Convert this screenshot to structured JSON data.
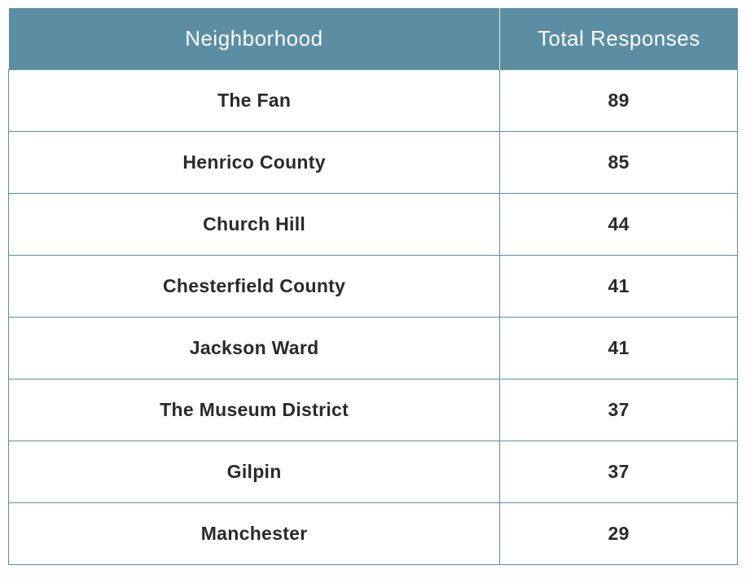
{
  "chart_data": {
    "type": "table",
    "title": "",
    "columns": [
      "Neighborhood",
      "Total Responses"
    ],
    "categories": [
      "The Fan",
      "Henrico County",
      "Church Hill",
      "Chesterfield County",
      "Jackson Ward",
      "The Museum District",
      "Gilpin",
      "Manchester"
    ],
    "values": [
      89,
      85,
      44,
      41,
      41,
      37,
      37,
      29
    ]
  },
  "headers": {
    "col1": "Neighborhood",
    "col2": "Total Responses"
  },
  "rows": [
    {
      "name": "The Fan",
      "value": "89"
    },
    {
      "name": "Henrico County",
      "value": "85"
    },
    {
      "name": "Church Hill",
      "value": "44"
    },
    {
      "name": "Chesterfield County",
      "value": "41"
    },
    {
      "name": "Jackson Ward",
      "value": "41"
    },
    {
      "name": "The Museum District",
      "value": "37"
    },
    {
      "name": "Gilpin",
      "value": "37"
    },
    {
      "name": "Manchester",
      "value": "29"
    }
  ]
}
